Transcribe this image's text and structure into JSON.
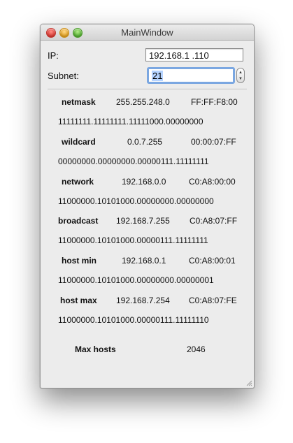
{
  "window": {
    "title": "MainWindow"
  },
  "form": {
    "ip_label": "IP:",
    "ip_value": "192.168.1  .110",
    "subnet_label": "Subnet:",
    "subnet_value": "21"
  },
  "rows": [
    {
      "name": "netmask",
      "dotted": "255.255.248.0",
      "hex": "FF:FF:F8:00",
      "binary": "11111111.11111111.11111000.00000000"
    },
    {
      "name": "wildcard",
      "dotted": "0.0.7.255",
      "hex": "00:00:07:FF",
      "binary": "00000000.00000000.00000111.11111111"
    },
    {
      "name": "network",
      "dotted": "192.168.0.0",
      "hex": "C0:A8:00:00",
      "binary": "11000000.10101000.00000000.00000000"
    },
    {
      "name": "broadcast",
      "dotted": "192.168.7.255",
      "hex": "C0:A8:07:FF",
      "binary": "11000000.10101000.00000111.11111111"
    },
    {
      "name": "host min",
      "dotted": "192.168.0.1",
      "hex": "C0:A8:00:01",
      "binary": "11000000.10101000.00000000.00000001"
    },
    {
      "name": "host max",
      "dotted": "192.168.7.254",
      "hex": "C0:A8:07:FE",
      "binary": "11000000.10101000.00000111.11111110"
    }
  ],
  "summary": {
    "label": "Max hosts",
    "value": "2046"
  },
  "icons": {
    "close": "close-button-red",
    "minimize": "minimize-button-yellow",
    "zoom": "zoom-button-green",
    "stepper": "up-down-stepper",
    "resize": "resize-grip"
  },
  "colors": {
    "window_bg": "#ececec",
    "focus_ring": "#7ba7e1",
    "selection": "#b5d3ff"
  }
}
